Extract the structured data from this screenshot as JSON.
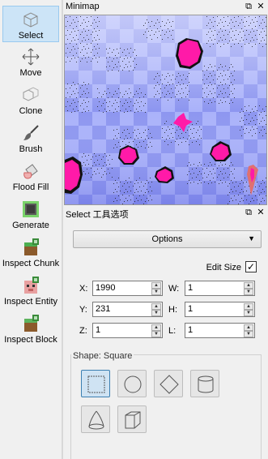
{
  "toolbar": {
    "tools": [
      {
        "label": "Select",
        "icon": "select-cube-icon",
        "active": true
      },
      {
        "label": "Move",
        "icon": "move-arrows-icon",
        "active": false
      },
      {
        "label": "Clone",
        "icon": "clone-cubes-icon",
        "active": false
      },
      {
        "label": "Brush",
        "icon": "brush-icon",
        "active": false
      },
      {
        "label": "Flood Fill",
        "icon": "flood-fill-icon",
        "active": false
      },
      {
        "label": "Generate",
        "icon": "generate-cube-icon",
        "active": false
      },
      {
        "label": "Inspect Chunk",
        "icon": "inspect-chunk-icon",
        "active": false
      },
      {
        "label": "Inspect Entity",
        "icon": "inspect-entity-icon",
        "active": false
      },
      {
        "label": "Inspect Block",
        "icon": "inspect-block-icon",
        "active": false
      }
    ]
  },
  "minimap": {
    "title": "Minimap",
    "float_icon": "⧉",
    "close_icon": "✕"
  },
  "tool_options": {
    "title": "Select 工具选项",
    "float_icon": "⧉",
    "close_icon": "✕",
    "options_button": "Options",
    "edit_size_label": "Edit Size",
    "edit_size_checked": "✓",
    "fields": {
      "x": {
        "label": "X:",
        "value": "1990"
      },
      "y": {
        "label": "Y:",
        "value": "231"
      },
      "z": {
        "label": "Z:",
        "value": "1"
      },
      "w": {
        "label": "W:",
        "value": "1"
      },
      "h": {
        "label": "H:",
        "value": "1"
      },
      "l": {
        "label": "L:",
        "value": "1"
      }
    },
    "shape_label": "Shape: Square",
    "shapes": [
      "square",
      "sphere",
      "diamond",
      "cylinder",
      "cone",
      "box"
    ]
  },
  "colors": {
    "accent": "#cce4f7",
    "minimap_light": "#aab2fa",
    "minimap_dark": "#7f88ea",
    "blob": "#ff1aa8"
  }
}
